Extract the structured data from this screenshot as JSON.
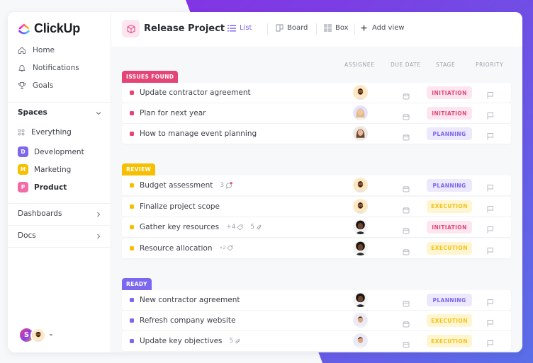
{
  "app": {
    "name": "ClickUp"
  },
  "colors": {
    "accent": "#7b68ee",
    "issues": "#e44476",
    "review": "#f6c000",
    "ready": "#7b68ee",
    "initiation_bg": "#fde6ef",
    "initiation_fg": "#e44476",
    "planning_bg": "#ece9fd",
    "planning_fg": "#7b68ee",
    "execution_bg": "#fff5d1",
    "execution_fg": "#f3c316"
  },
  "sidebar": {
    "nav": [
      {
        "label": "Home",
        "icon": "home-icon"
      },
      {
        "label": "Notifications",
        "icon": "bell-icon"
      },
      {
        "label": "Goals",
        "icon": "trophy-icon"
      }
    ],
    "spaces_title": "Spaces",
    "everything_label": "Everything",
    "spaces": [
      {
        "letter": "D",
        "label": "Development",
        "color": "#7b68ee",
        "bold": false
      },
      {
        "letter": "M",
        "label": "Marketing",
        "color": "#f6c000",
        "bold": false
      },
      {
        "letter": "P",
        "label": "Product",
        "color": "#f36ba6",
        "bold": true
      }
    ],
    "dashboards_label": "Dashboards",
    "docs_label": "Docs",
    "user_initial": "S"
  },
  "header": {
    "project_title": "Release Project",
    "views": [
      {
        "label": "List",
        "icon": "list-icon",
        "active": true
      },
      {
        "label": "Board",
        "icon": "board-icon",
        "active": false
      },
      {
        "label": "Box",
        "icon": "box-icon",
        "active": false
      }
    ],
    "add_view_label": "Add view"
  },
  "columns": {
    "assignee": "ASSIGNEE",
    "due_date": "DUE DATE",
    "stage": "STAGE",
    "priority": "PRIORITY"
  },
  "groups": [
    {
      "label": "ISSUES FOUND",
      "color": "#e44476",
      "tasks": [
        {
          "name": "Update contractor agreement",
          "stage": "INITIATION",
          "avatar": "man-dark-beard"
        },
        {
          "name": "Plan for next year",
          "stage": "INITIATION",
          "avatar": "woman-blonde"
        },
        {
          "name": "How to manage event planning",
          "stage": "PLANNING",
          "avatar": "woman-brunette"
        }
      ]
    },
    {
      "label": "REVIEW",
      "color": "#f6c000",
      "tasks": [
        {
          "name": "Budget assessment",
          "meta": [
            {
              "text": "3",
              "icon": "comment-icon"
            }
          ],
          "stage": "PLANNING",
          "avatar": "man-dark-beard"
        },
        {
          "name": "Finalize project scope",
          "stage": "EXECUTION",
          "avatar": "man-dark-beard"
        },
        {
          "name": "Gather key resources",
          "meta": [
            {
              "text": "+4",
              "icon": "tag-icon"
            },
            {
              "text": "5",
              "icon": "paperclip-icon"
            }
          ],
          "stage": "INITIATION",
          "avatar": "man-afro"
        },
        {
          "name": "Resource allocation",
          "meta": [
            {
              "text": "+2",
              "icon": "tag-icon",
              "small": true
            }
          ],
          "stage": "EXECUTION",
          "avatar": "man-afro"
        }
      ]
    },
    {
      "label": "READY",
      "color": "#7b68ee",
      "tasks": [
        {
          "name": "New contractor agreement",
          "stage": "PLANNING",
          "avatar": "man-afro"
        },
        {
          "name": "Refresh company website",
          "stage": "EXECUTION",
          "avatar": "man-short-hair"
        },
        {
          "name": "Update key objectives",
          "meta": [
            {
              "text": "5",
              "icon": "paperclip-icon"
            }
          ],
          "stage": "EXECUTION",
          "avatar": "man-short-hair"
        }
      ]
    }
  ]
}
